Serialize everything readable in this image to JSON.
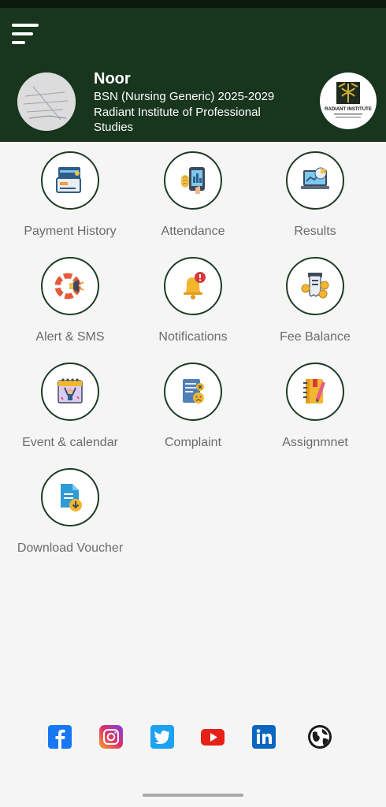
{
  "profile": {
    "name": "Noor",
    "program": "BSN (Nursing Generic) 2025-2029",
    "institute": "Radiant Institute of Professional Studies",
    "logo_text": "RADIANT INSTITUTE"
  },
  "menu": [
    {
      "label": "Payment History",
      "icon": "payment-history-icon"
    },
    {
      "label": "Attendance",
      "icon": "attendance-icon"
    },
    {
      "label": "Results",
      "icon": "results-icon"
    },
    {
      "label": "Alert & SMS",
      "icon": "alert-sms-icon"
    },
    {
      "label": "Notifications",
      "icon": "notifications-icon"
    },
    {
      "label": "Fee Balance",
      "icon": "fee-balance-icon"
    },
    {
      "label": "Event & calendar",
      "icon": "event-calendar-icon"
    },
    {
      "label": "Complaint",
      "icon": "complaint-icon"
    },
    {
      "label": "Assignmnet",
      "icon": "assignment-icon"
    },
    {
      "label": "Download Voucher",
      "icon": "download-voucher-icon"
    }
  ],
  "social": [
    "facebook-icon",
    "instagram-icon",
    "twitter-icon",
    "youtube-icon",
    "linkedin-icon",
    "website-globe-icon"
  ],
  "colors": {
    "header": "#18351d",
    "accent_border": "#1f3b24",
    "label": "#6b6b6b"
  }
}
